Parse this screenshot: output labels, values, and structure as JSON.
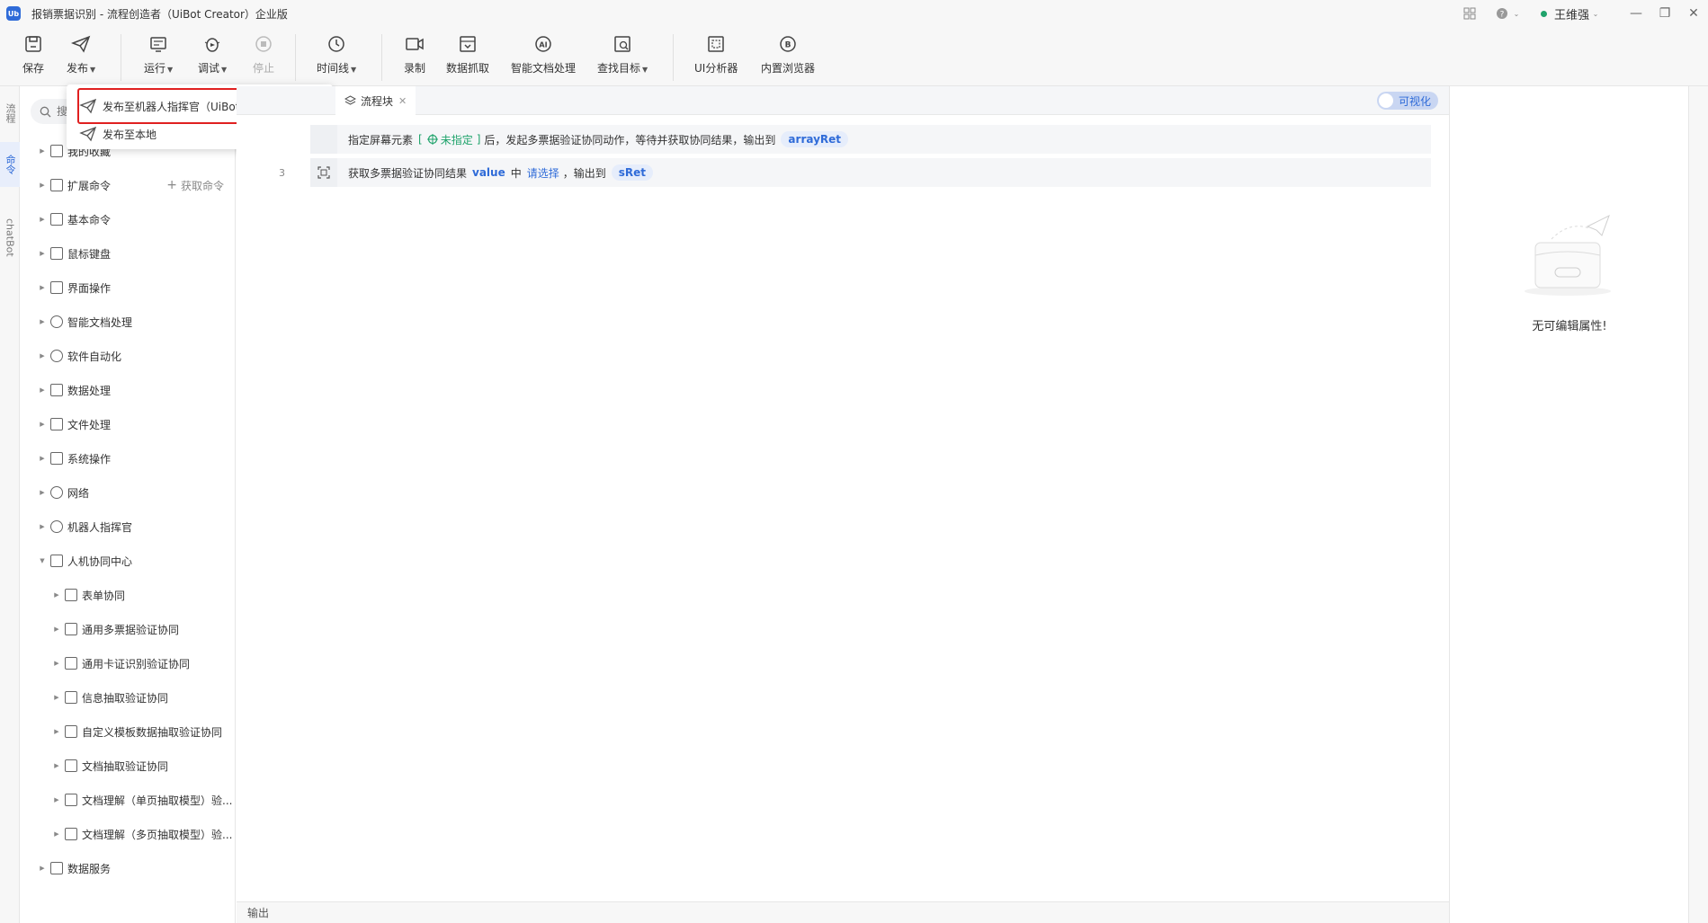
{
  "window": {
    "logo_text": "Ub",
    "title": "报销票据识别 - 流程创造者（UiBot Creator）企业版",
    "user": "王维强"
  },
  "toolbar": {
    "save": "保存",
    "publish": "发布",
    "run": "运行",
    "debug": "调试",
    "stop": "停止",
    "timeline": "时间线",
    "record": "录制",
    "data_scrape": "数据抓取",
    "smart_doc": "智能文档处理",
    "find_target": "查找目标",
    "ui_analyzer": "UI分析器",
    "builtin_browser": "内置浏览器"
  },
  "left_rail": {
    "tabs": [
      "流程",
      "命令",
      "chatBot"
    ]
  },
  "publish_menu": {
    "items": [
      "发布至机器人指挥官（UiBot Commander)",
      "发布至本地"
    ]
  },
  "command_panel": {
    "search_placeholder": "搜索命令",
    "get_commands": "获取命令",
    "tree": [
      {
        "label": "我的收藏"
      },
      {
        "label": "扩展命令"
      },
      {
        "label": "基本命令"
      },
      {
        "label": "鼠标键盘"
      },
      {
        "label": "界面操作"
      },
      {
        "label": "智能文档处理"
      },
      {
        "label": "软件自动化"
      },
      {
        "label": "数据处理"
      },
      {
        "label": "文件处理"
      },
      {
        "label": "系统操作"
      },
      {
        "label": "网络"
      },
      {
        "label": "机器人指挥官"
      },
      {
        "label": "人机协同中心"
      },
      {
        "label": "表单协同"
      },
      {
        "label": "通用多票据验证协同"
      },
      {
        "label": "通用卡证识别验证协同"
      },
      {
        "label": "信息抽取验证协同"
      },
      {
        "label": "自定义模板数据抽取验证协同"
      },
      {
        "label": "文档抽取验证协同"
      },
      {
        "label": "文档理解（单页抽取模型）验..."
      },
      {
        "label": "文档理解（多页抽取模型）验..."
      },
      {
        "label": "数据服务"
      }
    ]
  },
  "editor": {
    "tab": "流程块",
    "visual_toggle": "可视化",
    "lines": [
      {
        "no": "",
        "p1": "指定屏幕元素",
        "lb": "[",
        "target": "未指定",
        "rb": "]",
        "p2": "后，发起多票据验证协同动作，等待并获取协同结果，输出到",
        "var": "arrayRet"
      },
      {
        "no": "3",
        "p1": "获取多票据验证协同结果",
        "kw1": "value",
        "p2": "中",
        "kw2": "请选择",
        "p3": "，输出到",
        "var": "sRet"
      }
    ],
    "output_label": "输出"
  },
  "properties": {
    "empty_text": "无可编辑属性!"
  }
}
